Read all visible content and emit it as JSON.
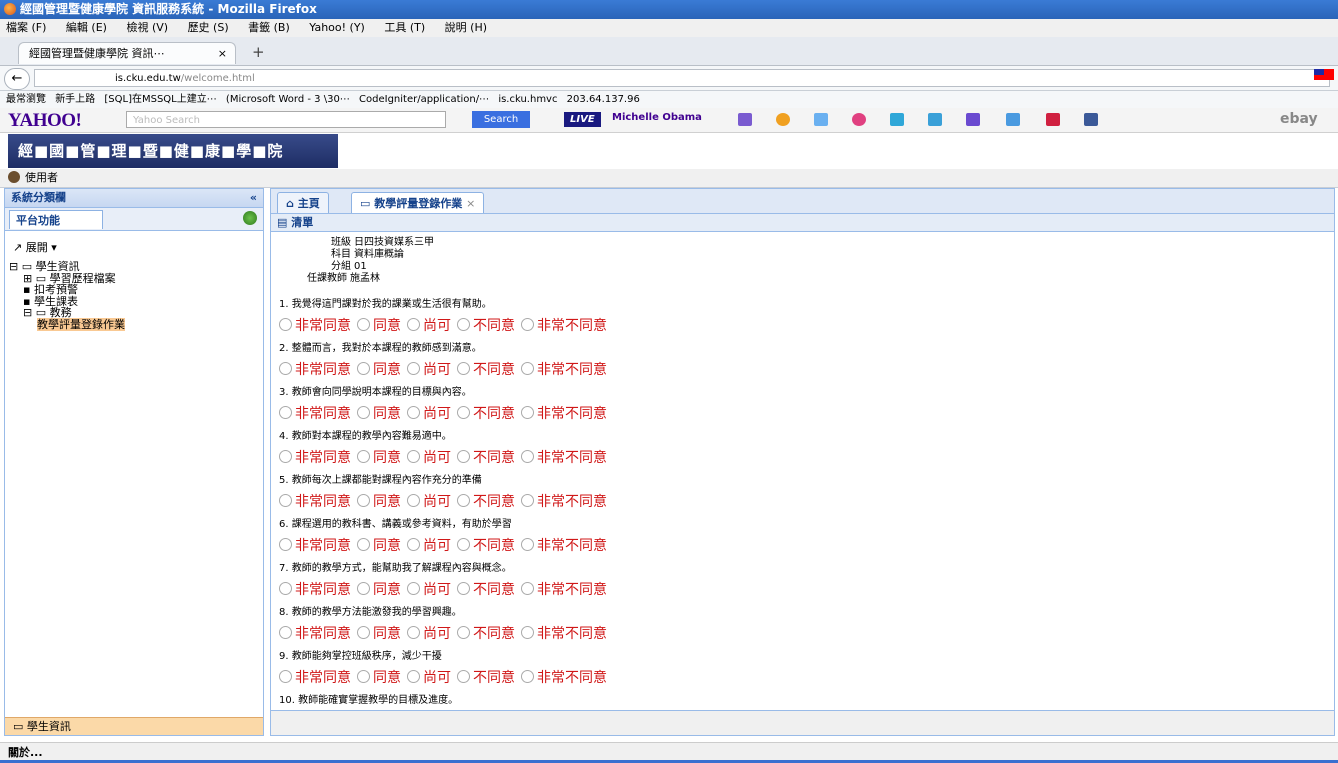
{
  "window": {
    "title": "經國管理暨健康學院 資訊服務系統 - Mozilla Firefox"
  },
  "menu": [
    "檔案 (F)",
    "編輯 (E)",
    "檢視 (V)",
    "歷史 (S)",
    "書籤 (B)",
    "Yahoo! (Y)",
    "工具 (T)",
    "說明 (H)"
  ],
  "browser_tab": {
    "label": "經國管理暨健康學院 資訊⋯",
    "close": "×",
    "new_tab": "+"
  },
  "url": {
    "host": "is.cku.edu.tw",
    "path": "/welcome.html"
  },
  "bookmarks": [
    "最常瀏覽",
    "新手上路",
    "[SQL]在MSSQL上建立⋯",
    "(Microsoft Word - 3 \\30⋯",
    "CodeIgniter/application/⋯",
    "is.cku.hmvc",
    "203.64.137.96"
  ],
  "yahoo": {
    "logo": "YAHOO!",
    "placeholder": "Yahoo Search",
    "search_label": "Search",
    "live": "LIVE",
    "trend": "Michelle Obama",
    "ebay": "ebay"
  },
  "app": {
    "banner": "經■國■管■理■暨■健■康■學■院",
    "user_label": "使用者"
  },
  "left_panel": {
    "title": "系統分類欄",
    "collapse": "«",
    "tab": "平台功能",
    "expand": "展開",
    "tree": [
      {
        "label": "學生資訊",
        "level": 0
      },
      {
        "label": "學習歷程檔案",
        "level": 1
      },
      {
        "label": "扣考預警",
        "level": 1
      },
      {
        "label": "學生課表",
        "level": 1
      },
      {
        "label": "教務",
        "level": 1
      },
      {
        "label": "教學評量登錄作業",
        "level": 2,
        "selected": true
      }
    ],
    "footer": "學生資訊"
  },
  "right_panel": {
    "tabs": [
      {
        "label": "主頁"
      },
      {
        "label": "教學評量登錄作業"
      }
    ],
    "toolbar": "清單",
    "info": [
      {
        "label": "班級",
        "value": "日四技資媒系三甲"
      },
      {
        "label": "科目",
        "value": "資料庫概論"
      },
      {
        "label": "分組",
        "value": "01"
      },
      {
        "label": "任課教師",
        "value": "施孟林"
      }
    ],
    "options": [
      "非常同意",
      "同意",
      "尚可",
      "不同意",
      "非常不同意"
    ],
    "questions": [
      "1. 我覺得這門課對於我的課業或生活很有幫助。",
      "2. 整體而言，我對於本課程的教師感到滿意。",
      "3. 教師會向同學說明本課程的目標與內容。",
      "4. 教師對本課程的教學內容難易適中。",
      "5. 教師每次上課都能對課程內容作充分的準備",
      "6. 課程選用的教科書、講義或參考資料，有助於學習",
      "7. 教師的教學方式，能幫助我了解課程內容與概念。",
      "8. 教師的教學方法能激發我的學習興趣。",
      "9. 教師能夠掌控班級秩序，減少干擾",
      "10. 教師能確實掌握教學的目標及進度。"
    ]
  },
  "status": {
    "text": "關於..."
  }
}
